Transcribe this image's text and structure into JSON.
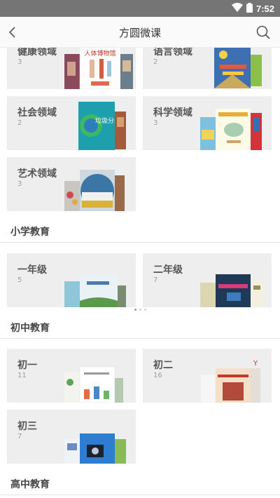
{
  "status_bar": {
    "time": "7:52"
  },
  "header": {
    "title": "方圆微课"
  },
  "preschool": {
    "cards": [
      {
        "name": "健康领域",
        "count": "3",
        "cover_text": "人体博物馆"
      },
      {
        "name": "语言领域",
        "count": "2"
      },
      {
        "name": "社会领域",
        "count": "2",
        "cover_text": "垃圾分类"
      },
      {
        "name": "科学领域",
        "count": "3"
      },
      {
        "name": "艺术领域",
        "count": "3"
      }
    ]
  },
  "primary": {
    "title": "小学教育",
    "cards": [
      {
        "name": "一年级",
        "count": "5"
      },
      {
        "name": "二年级",
        "count": "7"
      }
    ]
  },
  "junior": {
    "title": "初中教育",
    "cards": [
      {
        "name": "初一",
        "count": "11"
      },
      {
        "name": "初二",
        "count": "16"
      },
      {
        "name": "初三",
        "count": "7"
      }
    ]
  },
  "senior": {
    "title": "高中教育"
  },
  "colors": {
    "status_bar": "#757575",
    "card_bg": "#eeeeee"
  }
}
